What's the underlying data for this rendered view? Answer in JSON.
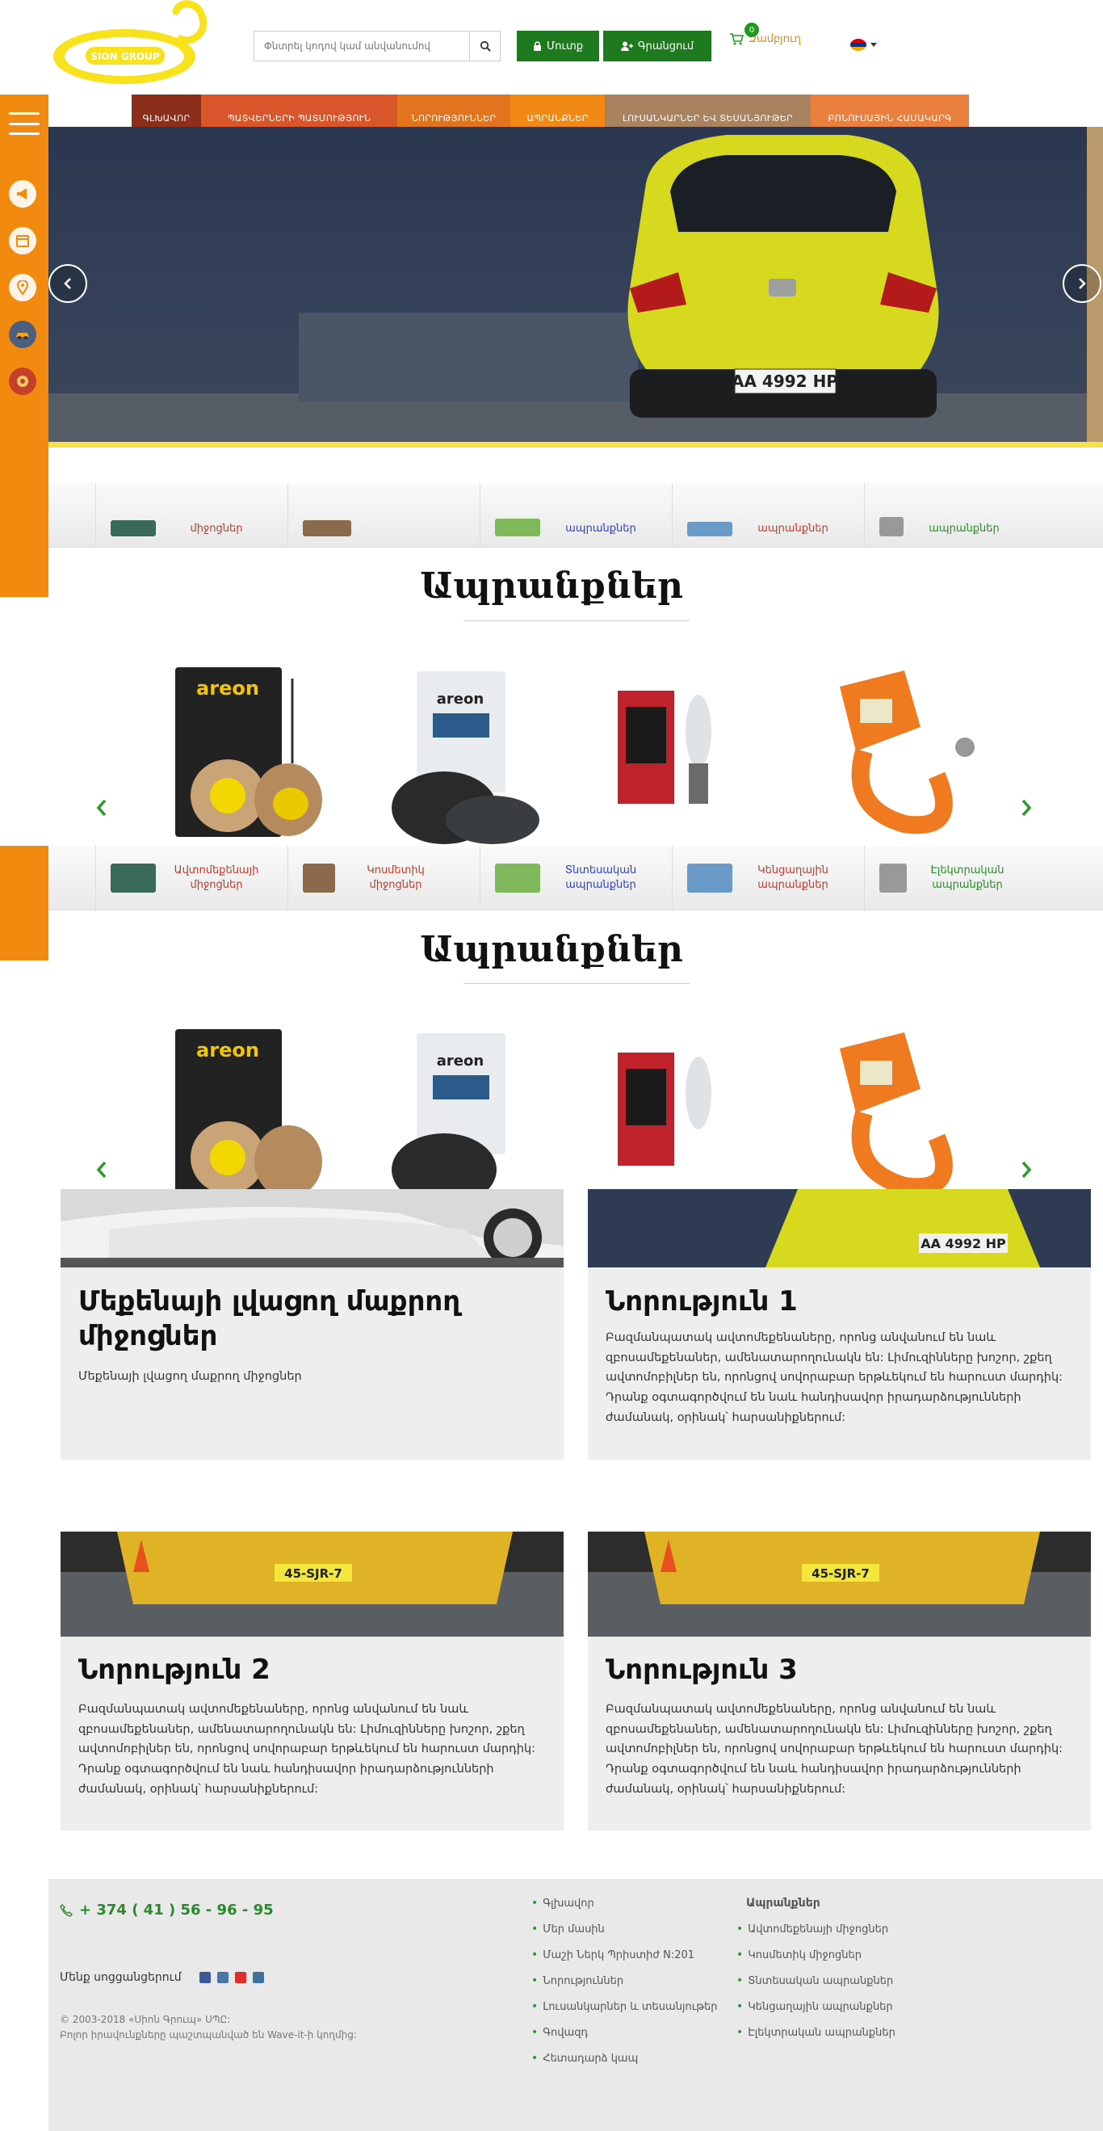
{
  "header": {
    "logo_text": "SION GROUP",
    "search": {
      "placeholder": "Փնտրել կոդով կամ անվանումով"
    },
    "login_label": "Մուտք",
    "register_label": "Գրանցում",
    "cart_label": "Զամբյուղ",
    "cart_count": "0"
  },
  "nav": [
    {
      "label": "ԳԼԽԱՎՈՐ",
      "color": "#8b2e1a"
    },
    {
      "label": "ՊԱՏՎԵՐՆԵՐԻ ՊԱՏՄՈՒԹՅՈՒՆ",
      "color": "#d9552a"
    },
    {
      "label": "ՆՈՐՈՒԹՅՈՒՆՆԵՐ",
      "color": "#e2741e"
    },
    {
      "label": "ԱՊՐԱՆՔՆԵՐ",
      "color": "#f08a15"
    },
    {
      "label": "ԼՈՒՍԱՆԿԱՐՆԵՐ ԵՎ ՏԵՍԱՆՅՈՒԹԵՐ",
      "color": "#a98260"
    },
    {
      "label": "ԲՈՆՈՒՍԱՅԻՆ ՀԱՄԱԿԱՐԳ",
      "color": "#e9803d"
    }
  ],
  "categories_clipped": [
    {
      "label": "միջոցներ",
      "color": "#c0392b"
    },
    {
      "label": "",
      "color": "#c0392b"
    },
    {
      "label": "",
      "color": "#c0392b"
    },
    {
      "label": "ապրանքներ",
      "color": "#2f3fbf"
    },
    {
      "label": "ապրանքներ",
      "color": "#c0392b"
    },
    {
      "label": "ապրանքներ",
      "color": "#2a8a2a"
    }
  ],
  "categories": [
    {
      "label": "Ավտոմեքենայի միջոցներ",
      "color": "#c0392b"
    },
    {
      "label": "Կոսմետիկ միջոցներ",
      "color": "#c0392b"
    },
    {
      "label": "Տնտեսական ապրանքներ",
      "color": "#2f3fbf"
    },
    {
      "label": "Կենցաղային ապրանքներ",
      "color": "#c0392b"
    },
    {
      "label": "Էլեկտրական ապրանքներ",
      "color": "#2a8a2a"
    }
  ],
  "products_title": "Ապրանքներ",
  "products": [
    {
      "name": "areon-fresco"
    },
    {
      "name": "areon-ken"
    },
    {
      "name": "halogen-lamp"
    },
    {
      "name": "tow-strap"
    }
  ],
  "news": [
    {
      "title": "Մեքենայի լվացող մաքրող միջոցներ",
      "text": "Մեքենայի լվացող մաքրող միջոցներ"
    },
    {
      "title": "Նորություն 1",
      "text": "Բազմանպատակ ավտոմեքենաները, որոնց անվանում են նաև զբոսամեքենաներ, ամենատարողունակն են: Լիմուզինները խոշոր, շքեղ ավտոմոբիլներ են, որոնցով սովորաբար երթևեկում են հարուստ մարդիկ: Դրանք օգտագործվում են նաև հանդիսավոր իրադարձությունների ժամանակ, օրինակ՝ հարսանիքներում:"
    },
    {
      "title": "Նորություն 2",
      "text": "Բազմանպատակ ավտոմեքենաները, որոնց անվանում են նաև զբոսամեքենաներ, ամենատարողունակն են: Լիմուզինները խոշոր, շքեղ ավտոմոբիլներ են, որոնցով սովորաբար երթևեկում են հարուստ մարդիկ: Դրանք օգտագործվում են նաև հանդիսավոր իրադարձությունների ժամանակ, օրինակ՝ հարսանիքներում:"
    },
    {
      "title": "Նորություն 3",
      "text": "Բազմանպատակ ավտոմեքենաները, որոնց անվանում են նաև զբոսամեքենաներ, ամենատարողունակն են: Լիմուզինները խոշոր, շքեղ ավտոմոբիլներ են, որոնցով սովորաբար երթևեկում են հարուստ մարդիկ: Դրանք օգտագործվում են նաև հանդիսավոր իրադարձությունների ժամանակ, օրինակ՝ հարսանիքներում:"
    }
  ],
  "hero": {
    "plate": "AA 4992 HP"
  },
  "news_plates": {
    "card2": "AA 4992 HP",
    "card3": "45-SJR-7",
    "card4": "45-SJR-7"
  },
  "footer": {
    "phone": "+ 374 ( 41 ) 56 - 96 - 95",
    "follow_label": "Մենք սոցցանցերում",
    "copyright_line1": "© 2003-2018 «Սիոն Գրուպ» ՍՊԸ:",
    "copyright_line2": "Բոլոր իրավունքները պաշտպանված են Wave-it-ի կողմից:",
    "links": [
      "Գլխավոր",
      "Մեր մասին",
      "Մաշի Ներկ Պրիստիժ N:201",
      "Նորություններ",
      "Լուսանկարներ և տեսանյութեր",
      "Գովազդ",
      "Հետադարձ կապ"
    ],
    "products_head": "Ապրանքներ",
    "product_links": [
      "Ավտոմեքենայի միջոցներ",
      "Կոսմետիկ միջոցներ",
      "Տնտեսական ապրանքներ",
      "Կենցաղային ապրանքներ",
      "Էլեկտրական ապրանքներ"
    ]
  },
  "colors": {
    "accent": "#f28a10",
    "green": "#1f7a1f",
    "link_green": "#2a8a2a"
  }
}
